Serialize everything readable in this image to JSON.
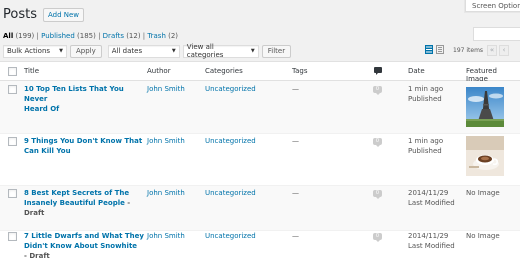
{
  "screen_options": "Screen Options",
  "page": {
    "title": "Posts",
    "add_new": "Add New"
  },
  "filters": {
    "all": "All",
    "all_count": "(199)",
    "published": "Published",
    "published_count": "(185)",
    "drafts": "Drafts",
    "drafts_count": "(12)",
    "trash": "Trash",
    "trash_count": "(2)"
  },
  "toolbar": {
    "bulk_actions": "Bulk Actions",
    "apply": "Apply",
    "dates": "All dates",
    "categories": "View all categories",
    "filter": "Filter",
    "items": "197 items",
    "first_page": "«",
    "prev_page": "‹"
  },
  "columns": {
    "title": "Title",
    "author": "Author",
    "categories": "Categories",
    "tags": "Tags",
    "date": "Date",
    "featured": "Featured Image"
  },
  "posts": [
    {
      "title_line1": "10 Top Ten Lists That You Never",
      "title_line2": "Heard Of",
      "state": "",
      "author": "John Smith",
      "category": "Uncategorized",
      "tags": "—",
      "comments": "0",
      "date_line1": "1 min ago",
      "date_line2": "Published",
      "image": "eiffel"
    },
    {
      "title_line1": "9 Things You Don't Know That",
      "title_line2": "Can Kill You",
      "state": "",
      "author": "John Smith",
      "category": "Uncategorized",
      "tags": "—",
      "comments": "0",
      "date_line1": "1 min ago",
      "date_line2": "Published",
      "image": "coffee"
    },
    {
      "title_line1": "8 Best Kept Secrets of The",
      "title_line2": "Insanely Beautiful People",
      "state": " - Draft",
      "author": "John Smith",
      "category": "Uncategorized",
      "tags": "—",
      "comments": "0",
      "date_line1": "2014/11/29",
      "date_line2": "Last Modified",
      "image_text": "No Image"
    },
    {
      "title_line1": "7 Little Dwarfs and What They",
      "title_line2": "Didn't Know About Snowhite",
      "title_line3": "- Draft",
      "author": "John Smith",
      "category": "Uncategorized",
      "tags": "—",
      "comments": "0",
      "date_line1": "2014/11/29",
      "date_line2": "Last Modified",
      "image_text": "No Image"
    }
  ]
}
